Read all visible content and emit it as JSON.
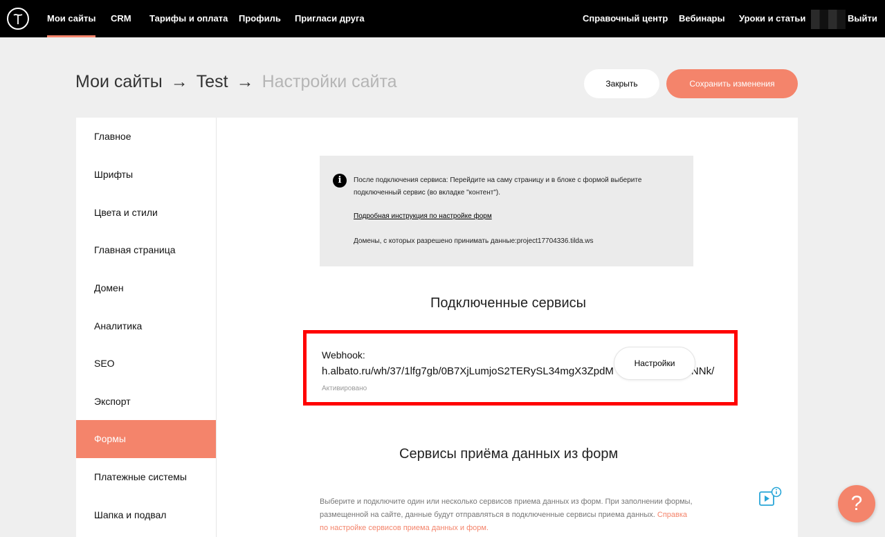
{
  "nav": {
    "left": [
      "Мои сайты",
      "CRM",
      "Тарифы и оплата",
      "Профиль",
      "Пригласи друга"
    ],
    "right": [
      "Справочный центр",
      "Вебинары",
      "Уроки и статьи"
    ],
    "logout": "Выйти"
  },
  "breadcrumb": {
    "root": "Мои сайты",
    "site": "Test",
    "current": "Настройки сайта",
    "arrow": "→"
  },
  "actions": {
    "close": "Закрыть",
    "save": "Сохранить изменения"
  },
  "sidebar": {
    "items": [
      "Главное",
      "Шрифты",
      "Цвета и стили",
      "Главная страница",
      "Домен",
      "Аналитика",
      "SEO",
      "Экспорт",
      "Формы",
      "Платежные системы",
      "Шапка и подвал"
    ],
    "active": "Формы"
  },
  "info": {
    "icon": "info-icon",
    "text": "После подключения сервиса: Перейдите на саму страницу и в блоке с формой выберите подключенный сервис (во вкладке \"контент\").",
    "link": "Подробная инструкция по настройке форм",
    "domains": "Домены, с которых разрешено принимать данные:project17704336.tilda.ws"
  },
  "connected": {
    "title": "Подключенные сервисы",
    "service": {
      "label": "Webhook:",
      "url": "h.albato.ru/wh/37/1lfg7gb/0B7XjLumjoS2TERySL34mgX3ZpdM",
      "url_tail": "NNk/",
      "status": "Активировано",
      "settings": "Настройки"
    }
  },
  "receivers": {
    "title": "Сервисы приёма данных из форм",
    "description": "Выберите и подключите один или несколько сервисов приема данных из форм. При заполнении формы, размещенной на сайте, данные будут отправляться в подключенные сервисы приема данных.",
    "help_link": "Справка по настройке сервисов приема данных и форм."
  },
  "help": {
    "label": "?"
  },
  "colors": {
    "accent": "#f4846b",
    "highlight": "#ff0000"
  }
}
